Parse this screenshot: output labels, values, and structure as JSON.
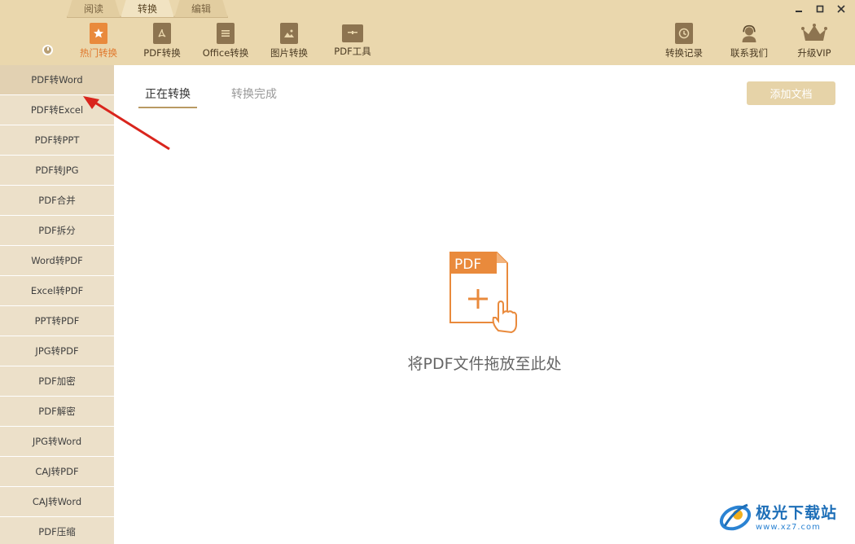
{
  "header": {
    "mode_tabs": [
      {
        "label": "阅读",
        "active": false
      },
      {
        "label": "转换",
        "active": true
      },
      {
        "label": "编辑",
        "active": false
      }
    ],
    "toolbar": [
      {
        "label": "热门转换",
        "icon": "star-doc-icon",
        "active": true
      },
      {
        "label": "PDF转换",
        "icon": "pdf-doc-icon",
        "active": false
      },
      {
        "label": "Office转换",
        "icon": "office-doc-icon",
        "active": false
      },
      {
        "label": "图片转换",
        "icon": "image-doc-icon",
        "active": false
      },
      {
        "label": "PDF工具",
        "icon": "toolbox-icon",
        "active": false
      }
    ],
    "right_tools": [
      {
        "label": "转换记录",
        "icon": "history-icon"
      },
      {
        "label": "联系我们",
        "icon": "headset-icon"
      },
      {
        "label": "升级VIP",
        "icon": "crown-icon"
      }
    ],
    "window_controls": [
      "minimize",
      "maximize",
      "close"
    ]
  },
  "sidebar": {
    "items": [
      {
        "label": "PDF转Word",
        "active": true
      },
      {
        "label": "PDF转Excel",
        "active": false
      },
      {
        "label": "PDF转PPT",
        "active": false
      },
      {
        "label": "PDF转JPG",
        "active": false
      },
      {
        "label": "PDF合并",
        "active": false
      },
      {
        "label": "PDF拆分",
        "active": false
      },
      {
        "label": "Word转PDF",
        "active": false
      },
      {
        "label": "Excel转PDF",
        "active": false
      },
      {
        "label": "PPT转PDF",
        "active": false
      },
      {
        "label": "JPG转PDF",
        "active": false
      },
      {
        "label": "PDF加密",
        "active": false
      },
      {
        "label": "PDF解密",
        "active": false
      },
      {
        "label": "JPG转Word",
        "active": false
      },
      {
        "label": "CAJ转PDF",
        "active": false
      },
      {
        "label": "CAJ转Word",
        "active": false
      },
      {
        "label": "PDF压缩",
        "active": false
      }
    ]
  },
  "main": {
    "tabs": [
      {
        "label": "正在转换",
        "active": true
      },
      {
        "label": "转换完成",
        "active": false
      }
    ],
    "add_button": "添加文档",
    "drop_icon_label": "PDF",
    "drop_text": "将PDF文件拖放至此处"
  },
  "watermark": {
    "cn": "极光下载站",
    "url": "www.xz7.com"
  },
  "colors": {
    "header_bg": "#ead7ad",
    "accent_orange": "#e98a3c",
    "sidebar_bg": "#ece0c9",
    "button_bg": "#e6d3a8",
    "arrow_red": "#d9251d"
  }
}
